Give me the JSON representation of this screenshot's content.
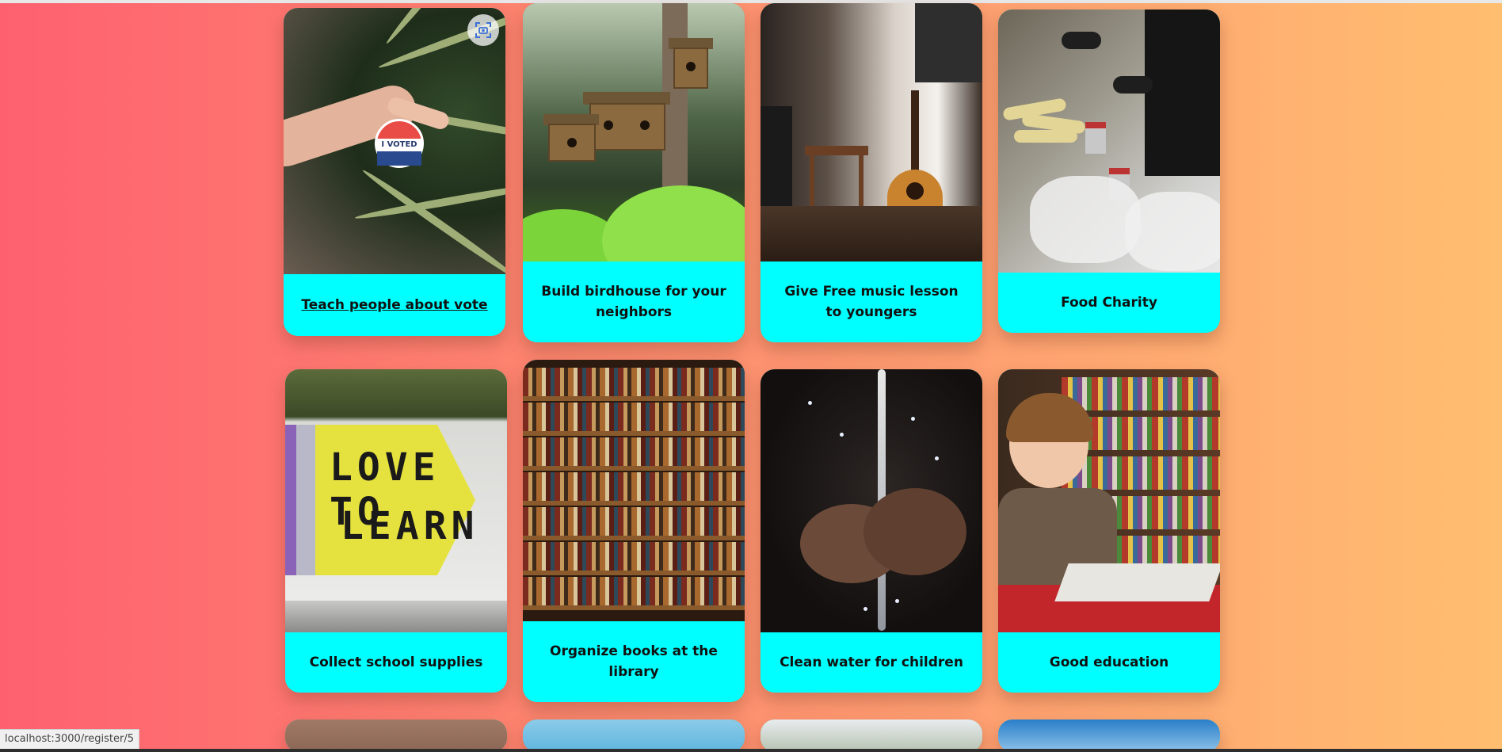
{
  "cards": [
    {
      "title": "Teach people about vote",
      "image": "i-voted-sticker-photo",
      "hovered": true
    },
    {
      "title": "Build birdhouse for your neighbors",
      "image": "birdhouses-in-forest-photo"
    },
    {
      "title": "Give Free music lesson to youngers",
      "image": "guitar-room-photo"
    },
    {
      "title": "Food Charity",
      "image": "food-donation-photo"
    },
    {
      "title": "Collect school supplies",
      "image": "love-to-learn-pencil-photo",
      "image_text": [
        "LOVE TO",
        "LEARN"
      ]
    },
    {
      "title": "Organize books at the library",
      "image": "library-bookshelves-photo"
    },
    {
      "title": "Clean water for children",
      "image": "water-in-hands-photo"
    },
    {
      "title": "Good education",
      "image": "boy-reading-photo"
    }
  ],
  "sticker": {
    "text": "I VOTED"
  },
  "status_bar": {
    "url": "localhost:3000/register/5"
  },
  "icons": {
    "screenshot": "screenshot-scan-icon"
  },
  "colors": {
    "card_background": "#00ffff",
    "gradient_left": "#fe6070",
    "gradient_right": "#ffbe70"
  }
}
